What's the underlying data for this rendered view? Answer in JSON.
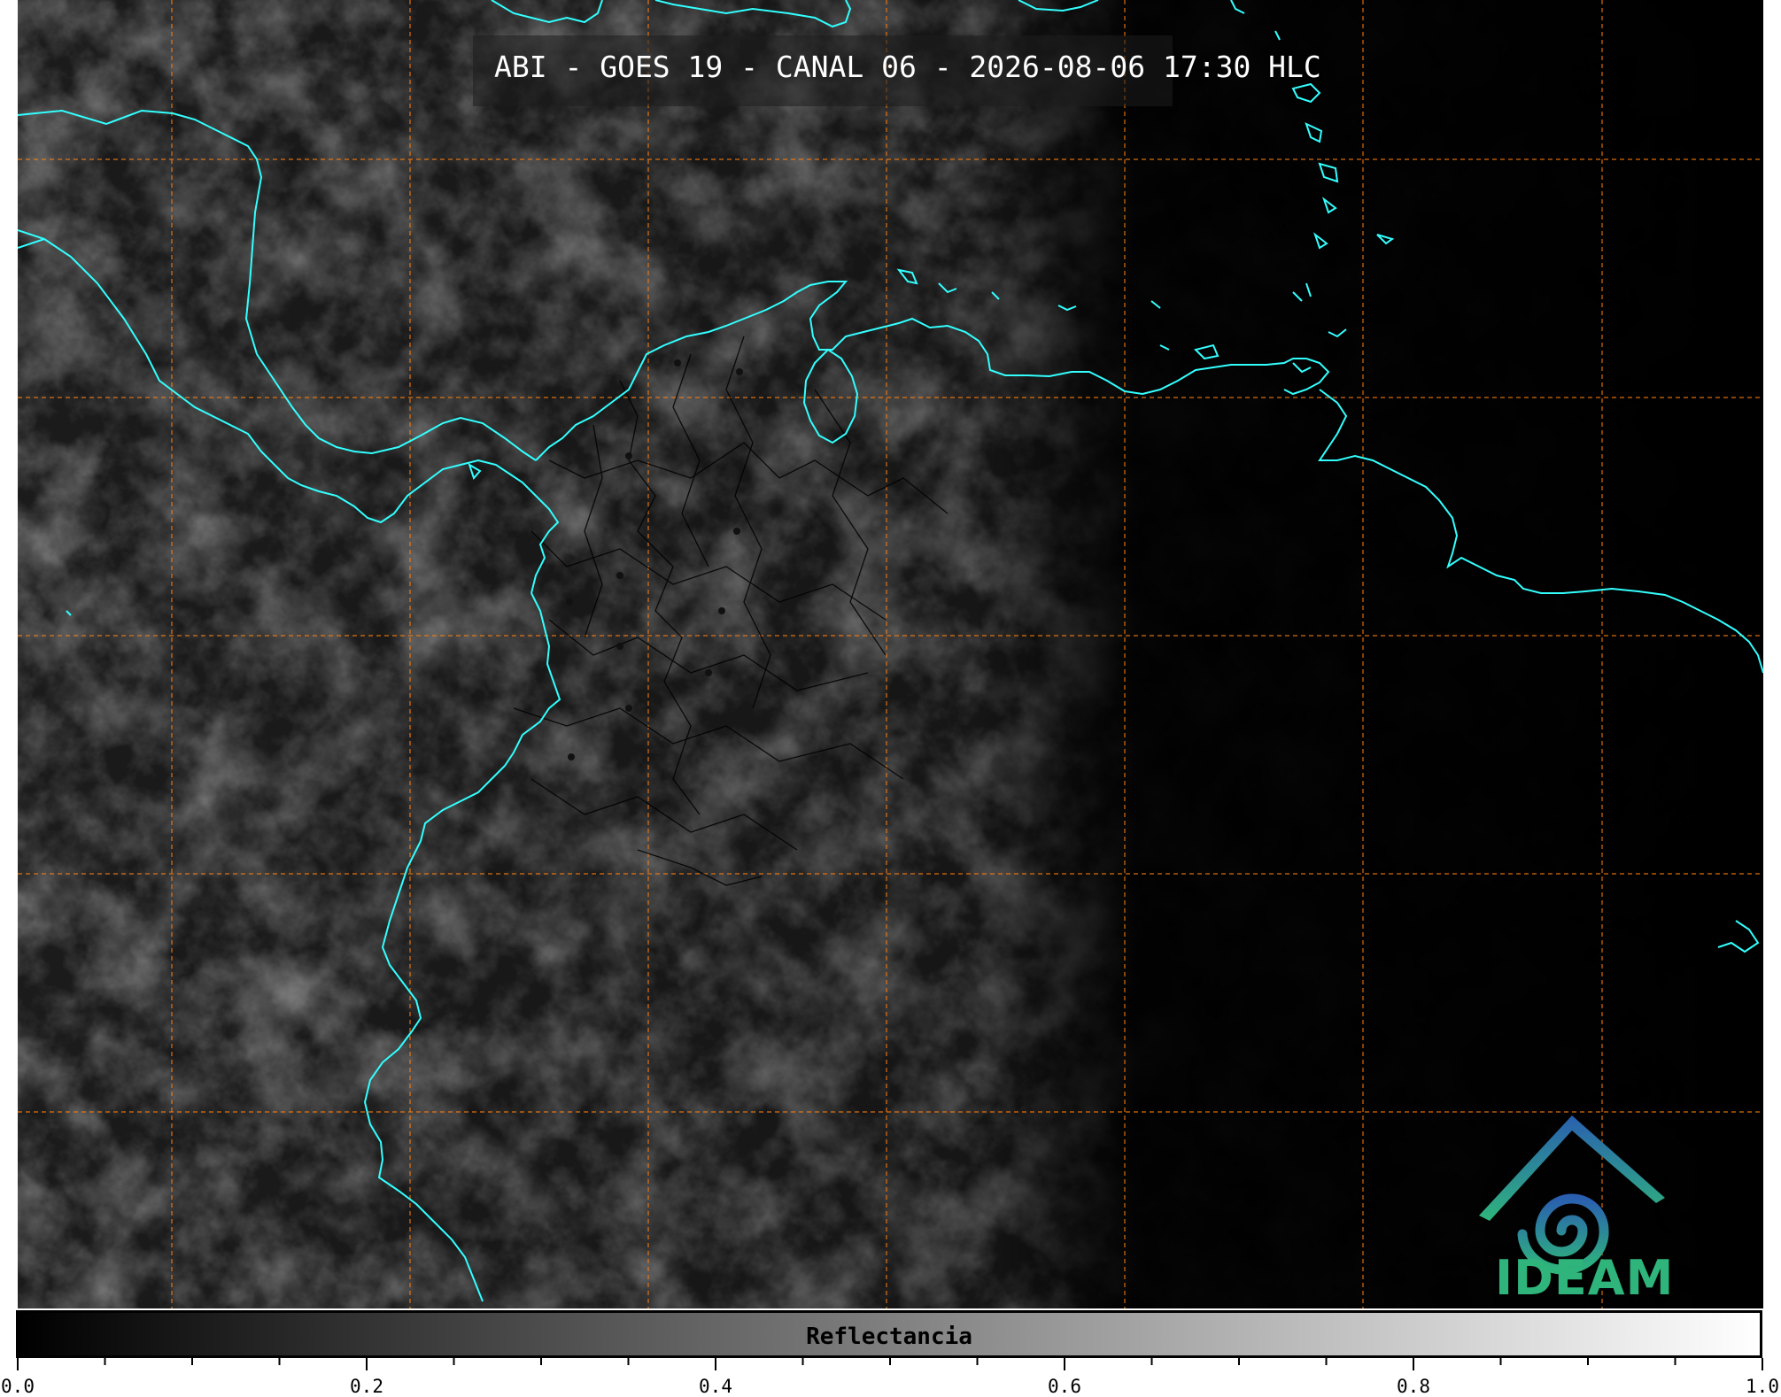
{
  "title": "ABI - GOES 19 - CANAL 06 - 2026-08-06 17:30 HLC",
  "colorbar": {
    "label": "Reflectancia",
    "ticks": [
      "0.0",
      "0.2",
      "0.4",
      "0.6",
      "0.8",
      "1.0"
    ],
    "min": 0.0,
    "max": 1.0,
    "colors": [
      "#000000",
      "#ffffff"
    ]
  },
  "logo": {
    "text": "IDEAM"
  },
  "map": {
    "coastline_color": "#33ffff",
    "grid_color": "#ff7f0e",
    "border_color": "#000000"
  }
}
